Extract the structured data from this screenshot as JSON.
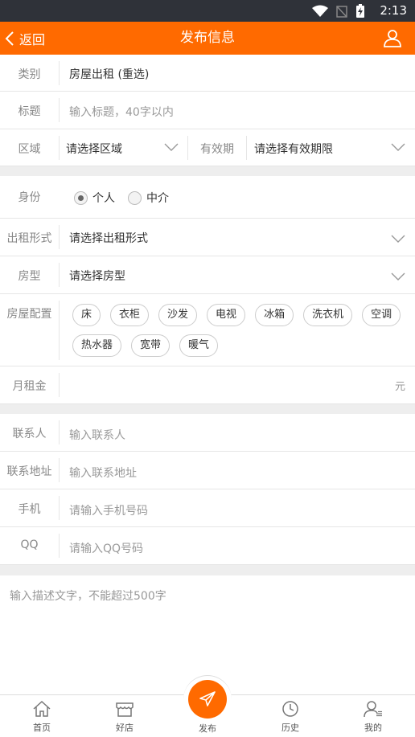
{
  "status_bar": {
    "time": "2:13"
  },
  "header": {
    "back_label": "返回",
    "title": "发布信息"
  },
  "form": {
    "category": {
      "label": "类别",
      "value": "房屋出租 (重选)"
    },
    "title": {
      "label": "标题",
      "placeholder": "输入标题，40字以内"
    },
    "area": {
      "label": "区域",
      "value": "请选择区域"
    },
    "validity": {
      "label": "有效期",
      "value": "请选择有效期限"
    },
    "identity": {
      "label": "身份",
      "options": [
        "个人",
        "中介"
      ],
      "selected": "个人"
    },
    "rent_type": {
      "label": "出租形式",
      "value": "请选择出租形式"
    },
    "house_type": {
      "label": "房型",
      "value": "请选择房型"
    },
    "facilities": {
      "label": "房屋配置",
      "tags": [
        "床",
        "衣柜",
        "沙发",
        "电视",
        "冰箱",
        "洗衣机",
        "空调",
        "热水器",
        "宽带",
        "暖气"
      ]
    },
    "rent": {
      "label": "月租金",
      "unit": "元"
    },
    "contact": {
      "label": "联系人",
      "placeholder": "输入联系人"
    },
    "address": {
      "label": "联系地址",
      "placeholder": "输入联系地址"
    },
    "phone": {
      "label": "手机",
      "placeholder": "请输入手机号码"
    },
    "qq": {
      "label": "QQ",
      "placeholder": "请输入QQ号码"
    },
    "description": {
      "placeholder": "输入描述文字，不能超过500字"
    }
  },
  "tabbar": {
    "items": [
      {
        "label": "首页",
        "icon": "home-icon"
      },
      {
        "label": "好店",
        "icon": "shop-icon"
      },
      {
        "label": "发布",
        "icon": "send-icon"
      },
      {
        "label": "历史",
        "icon": "clock-icon"
      },
      {
        "label": "我的",
        "icon": "profile-icon"
      }
    ]
  },
  "colors": {
    "accent": "#ff6a00",
    "status_bar": "#2f3239"
  }
}
